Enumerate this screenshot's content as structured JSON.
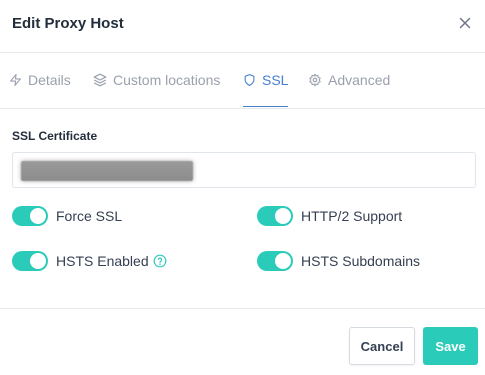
{
  "modal": {
    "title": "Edit Proxy Host"
  },
  "tabs": [
    {
      "label": "Details",
      "icon": "zap-icon",
      "active": false
    },
    {
      "label": "Custom locations",
      "icon": "layers-icon",
      "active": false
    },
    {
      "label": "SSL",
      "icon": "shield-icon",
      "active": true
    },
    {
      "label": "Advanced",
      "icon": "settings-icon",
      "active": false
    }
  ],
  "ssl": {
    "certificate_label": "SSL Certificate",
    "certificate_value_redacted": true
  },
  "toggles": [
    {
      "label": "Force SSL",
      "on": true
    },
    {
      "label": "HTTP/2 Support",
      "on": true
    },
    {
      "label": "HSTS Enabled",
      "on": true,
      "help_icon": "help-circle-icon"
    },
    {
      "label": "HSTS Subdomains",
      "on": true
    }
  ],
  "footer": {
    "cancel_label": "Cancel",
    "save_label": "Save"
  },
  "colors": {
    "accent": "#2bcbba",
    "tab_active": "#467fcf",
    "tab_inactive": "#9aa0ac"
  }
}
